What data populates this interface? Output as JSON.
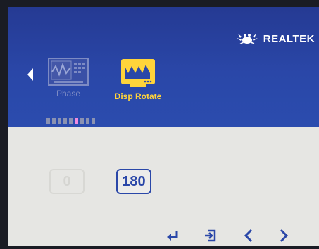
{
  "brand": {
    "name": "REALTEK"
  },
  "menu": {
    "items": [
      {
        "label": "Phase",
        "icon": "phase-icon",
        "selected": false
      },
      {
        "label": "Disp Rotate",
        "icon": "rotate-display-icon",
        "selected": true
      }
    ]
  },
  "options": [
    {
      "value": "0",
      "selected": false
    },
    {
      "value": "180",
      "selected": true
    }
  ],
  "colors": {
    "header_bg": "#2a47a8",
    "selected_accent": "#ffd43a",
    "option_accent": "#2a47a8",
    "pager_active": "#f08be0"
  }
}
